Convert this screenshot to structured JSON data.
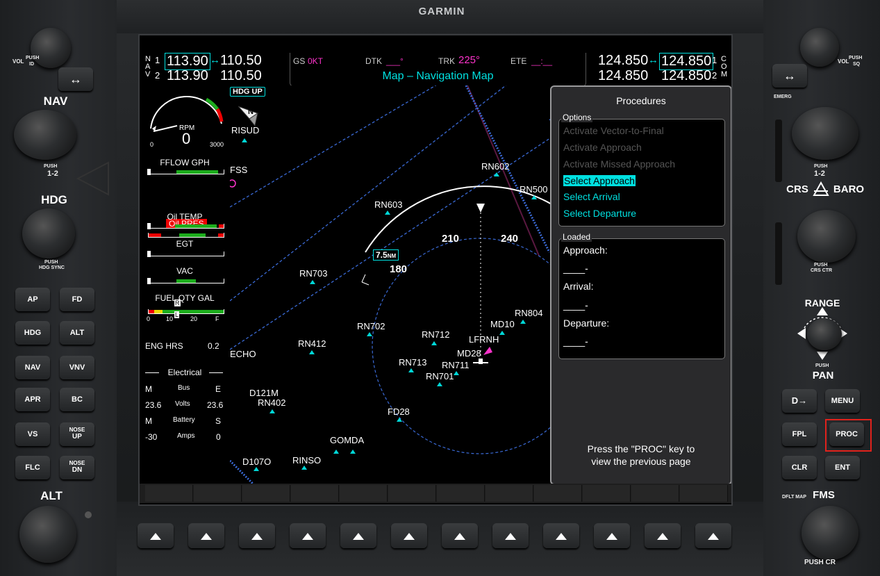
{
  "brand": "GARMIN",
  "nav": {
    "label_n": "N",
    "label_a": "A",
    "label_v": "V",
    "idx1": "1",
    "idx2": "2",
    "nav1_active": "113.90",
    "nav1_standby": "110.50",
    "nav2_active": "113.90",
    "nav2_standby": "110.50",
    "swap": "↔"
  },
  "com": {
    "com1_standby": "124.850",
    "com1_active": "124.850",
    "com2_standby": "124.850",
    "com2_active": "124.850",
    "idx1": "1",
    "idx2": "2",
    "label_c": "C",
    "label_o": "O",
    "label_m": "M",
    "swap": "↔"
  },
  "status": {
    "gs_label": "GS",
    "gs_value": "0KT",
    "dtk_label": "DTK",
    "dtk_value": "___°",
    "trk_label": "TRK",
    "trk_value": "225°",
    "ete_label": "ETE",
    "ete_value": "__:__",
    "page_title": "Map – Navigation Map"
  },
  "map": {
    "orientation": "HDG UP",
    "north": "N",
    "range": "7.5NM",
    "range_val": "7.5",
    "range_unit": "NM",
    "compass": [
      "180",
      "210",
      "240"
    ],
    "waypoints": [
      "RISUD",
      "FSS",
      "RN602",
      "RN500",
      "RN603",
      "RN703",
      "RN702",
      "RN412",
      "ECHO",
      "RN712",
      "MD10",
      "LFRNH",
      "RN804",
      "MD28",
      "RN713",
      "RN711",
      "RN701",
      "D121M",
      "RN402",
      "FD28",
      "GOMDA",
      "RINSO",
      "D107O"
    ]
  },
  "engine": {
    "rpm_label": "RPM",
    "rpm_value": "0",
    "rpm_min": "0",
    "rpm_max": "3000",
    "fflow": "FFLOW GPH",
    "oil_pres": "Oil PRES",
    "oil_temp": "Oil TEMP",
    "egt": "EGT",
    "vac": "VAC",
    "fuel_qty": "FUEL QTY GAL",
    "fuel_ticks": [
      "0",
      "10",
      "20",
      "F"
    ],
    "fuel_marker_r": "R",
    "fuel_marker_l": "L",
    "eng_hrs_label": "ENG HRS",
    "eng_hrs_value": "0.2",
    "electrical_title": "Electrical",
    "bus_m": "M",
    "bus_label": "Bus",
    "bus_e": "E",
    "volts_m": "23.6",
    "volts_label": "Volts",
    "volts_e": "23.6",
    "batt_m": "M",
    "batt_label": "Battery",
    "batt_s": "S",
    "amps_m": "-30",
    "amps_label": "Amps",
    "amps_s": "0"
  },
  "procedures": {
    "title": "Procedures",
    "options_label": "Options",
    "options": [
      {
        "label": "Activate Vector-to-Final",
        "state": "disabled"
      },
      {
        "label": "Activate Approach",
        "state": "disabled"
      },
      {
        "label": "Activate Missed Approach",
        "state": "disabled"
      },
      {
        "label": "Select Approach",
        "state": "selected"
      },
      {
        "label": "Select Arrival",
        "state": "enabled"
      },
      {
        "label": "Select Departure",
        "state": "enabled"
      }
    ],
    "loaded_label": "Loaded",
    "approach_label": "Approach:",
    "approach_value": "____-",
    "arrival_label": "Arrival:",
    "arrival_value": "____-",
    "departure_label": "Departure:",
    "departure_value": "____-",
    "footer_line1": "Press the \"PROC\" key to",
    "footer_line2": "view the previous page"
  },
  "left_panel": {
    "vol_label": "VOL",
    "vol_push": "PUSH",
    "vol_id": "ID",
    "nav_label": "NAV",
    "nav_push": "PUSH",
    "nav_12": "1-2",
    "hdg_label": "HDG",
    "hdg_push": "PUSH",
    "hdg_sync": "HDG SYNC",
    "buttons": [
      "AP",
      "FD",
      "HDG",
      "ALT",
      "NAV",
      "VNV",
      "APR",
      "BC",
      "VS",
      "FLC"
    ],
    "nose_up_top": "NOSE",
    "nose_up_bottom": "UP",
    "nose_dn_top": "NOSE",
    "nose_dn_bottom": "DN",
    "alt_label": "ALT"
  },
  "right_panel": {
    "vol_label": "VOL",
    "vol_push": "PUSH",
    "vol_sq": "SQ",
    "emerg": "EMERG",
    "com_push": "PUSH",
    "com_12": "1-2",
    "crs_label": "CRS",
    "baro_label": "BARO",
    "crs_push": "PUSH",
    "crs_ctr": "CRS CTR",
    "range_label": "RANGE",
    "range_push": "PUSH",
    "pan_label": "PAN",
    "direct_to": "D→",
    "menu": "MENU",
    "fpl": "FPL",
    "proc": "PROC",
    "clr": "CLR",
    "ent": "ENT",
    "dflt_map": "DFLT MAP",
    "fms_label": "FMS",
    "fms_push": "PUSH CR"
  }
}
